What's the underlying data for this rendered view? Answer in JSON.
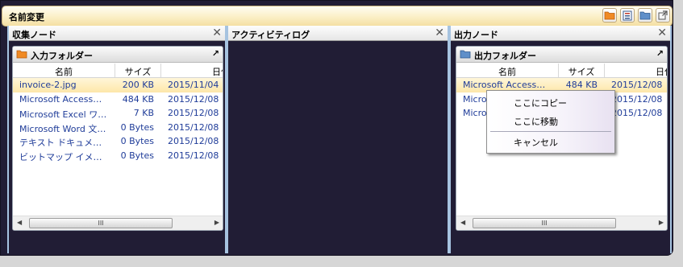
{
  "window": {
    "title": "名前変更",
    "toolbar_icons": [
      "orange-folder-icon",
      "document-list-icon",
      "blue-folder-icon",
      "external-link-icon"
    ]
  },
  "panels": {
    "collect": {
      "title": "収集ノード",
      "folder": {
        "title": "入力フォルダー",
        "columns": [
          "名前",
          "サイズ",
          "日付"
        ],
        "rows": [
          {
            "name": "invoice-2.jpg",
            "size": "200 KB",
            "date": "2015/11/04"
          },
          {
            "name": "Microsoft Access…",
            "size": "484 KB",
            "date": "2015/12/08"
          },
          {
            "name": "Microsoft Excel ワ…",
            "size": "7 KB",
            "date": "2015/12/08"
          },
          {
            "name": "Microsoft Word 文…",
            "size": "0 Bytes",
            "date": "2015/12/08"
          },
          {
            "name": "テキスト ドキュメ…",
            "size": "0 Bytes",
            "date": "2015/12/08"
          },
          {
            "name": "ビットマップ イメ…",
            "size": "0 Bytes",
            "date": "2015/12/08"
          }
        ],
        "scroll_grip": "III"
      }
    },
    "activity": {
      "title": "アクティビティログ"
    },
    "output": {
      "title": "出力ノード",
      "folder": {
        "title": "出力フォルダー",
        "columns": [
          "名前",
          "サイズ",
          "日付"
        ],
        "rows": [
          {
            "name": "Microsoft Access…",
            "size": "484 KB",
            "date": "2015/12/08"
          },
          {
            "name": "Microsoft Excel",
            "size": "",
            "date": "2015/12/08"
          },
          {
            "name": "Microsoft Word",
            "size": "",
            "date": "2015/12/08"
          }
        ],
        "scroll_grip": "III"
      }
    }
  },
  "context_menu": {
    "items": [
      "ここにコピー",
      "ここに移動",
      "キャンセル"
    ]
  },
  "colors": {
    "background": "#211d35",
    "panel_border": "#a6c3e0",
    "selection": "#fde7a9",
    "link_text": "#1f3c99"
  }
}
